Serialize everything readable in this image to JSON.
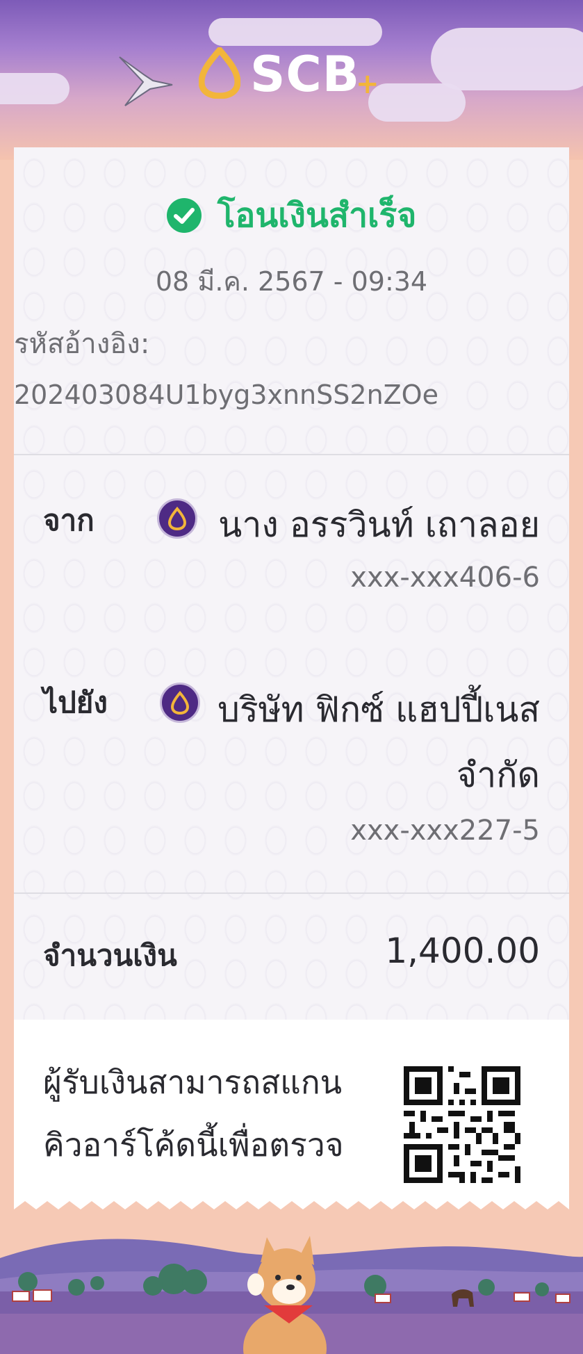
{
  "brand": {
    "name": "SCB",
    "plus": "+"
  },
  "status": {
    "text": "โอนเงินสำเร็จ",
    "icon": "check-circle-icon",
    "color": "#1fb56c"
  },
  "datetime": "08 มี.ค. 2567 - 09:34",
  "reference": {
    "label": "รหัสอ้างอิง:",
    "value": "202403084U1byg3xnnSS2nZOe"
  },
  "from": {
    "label": "จาก",
    "name": "นาง อรรวินท์ เถาลอย",
    "account": "xxx-xxx406-6",
    "bank_icon": "scb-bank-icon"
  },
  "to": {
    "label": "ไปยัง",
    "name_line1": "บริษัท ฟิกซ์ แฮปปี้เนส",
    "name_line2": "จำกัด",
    "account": "xxx-xxx227-5",
    "bank_icon": "scb-bank-icon"
  },
  "amount": {
    "label": "จำนวนเงิน",
    "value": "1,400.00"
  },
  "qr_note": {
    "line1": "ผู้รับเงินสามารถสแกน",
    "line2": "คิวอาร์โค้ดนี้เพื่อตรวจ"
  },
  "colors": {
    "brand_purple": "#4e2a84",
    "brand_gold": "#f2b53a",
    "success_green": "#1fb56c"
  }
}
